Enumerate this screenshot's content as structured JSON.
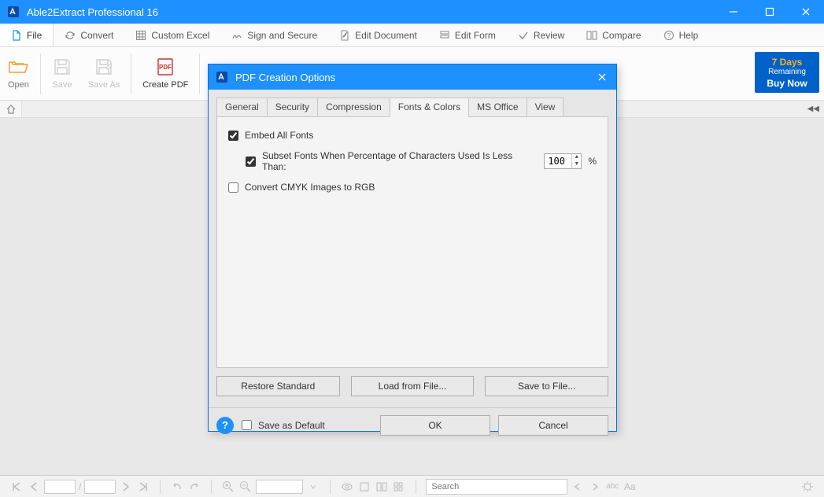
{
  "app": {
    "title": "Able2Extract Professional 16"
  },
  "menu": {
    "file": "File",
    "convert": "Convert",
    "custom_excel": "Custom Excel",
    "sign_secure": "Sign and Secure",
    "edit_document": "Edit Document",
    "edit_form": "Edit Form",
    "review": "Review",
    "compare": "Compare",
    "help": "Help"
  },
  "toolbar": {
    "open": "Open",
    "save": "Save",
    "save_as": "Save As",
    "create_pdf": "Create PDF"
  },
  "trial": {
    "days": "7 Days",
    "remaining": "Remaining",
    "buy": "Buy Now"
  },
  "dialog": {
    "title": "PDF Creation Options",
    "tabs": {
      "general": "General",
      "security": "Security",
      "compression": "Compression",
      "fonts_colors": "Fonts & Colors",
      "ms_office": "MS Office",
      "view": "View"
    },
    "embed_all_fonts": "Embed All Fonts",
    "subset_fonts": "Subset Fonts When Percentage of Characters Used Is Less Than:",
    "subset_value": "100",
    "percent": "%",
    "convert_cmyk": "Convert CMYK Images to RGB",
    "restore": "Restore Standard",
    "load": "Load from File...",
    "save": "Save to File...",
    "save_default": "Save as Default",
    "ok": "OK",
    "cancel": "Cancel"
  },
  "status": {
    "search_placeholder": "Search"
  }
}
